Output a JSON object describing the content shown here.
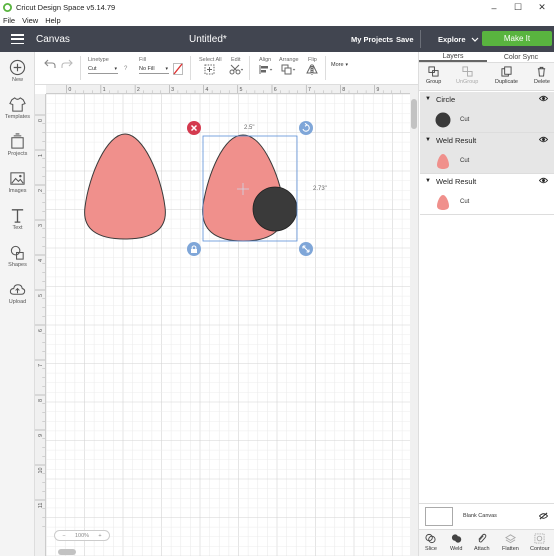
{
  "titlebar": {
    "title": "Cricut Design Space  v5.14.79"
  },
  "menu": [
    "File",
    "View",
    "Help"
  ],
  "header": {
    "canvas_label": "Canvas",
    "doc_title": "Untitled*",
    "my_projects": "My Projects",
    "save": "Save",
    "machine": "Explore",
    "make_it": "Make It",
    "accent": "#59b43f"
  },
  "sidebar": [
    {
      "label": "New",
      "icon": "plus-circle-icon"
    },
    {
      "label": "Templates",
      "icon": "shirt-icon"
    },
    {
      "label": "Projects",
      "icon": "projects-icon"
    },
    {
      "label": "Images",
      "icon": "image-icon"
    },
    {
      "label": "Text",
      "icon": "text-icon"
    },
    {
      "label": "Shapes",
      "icon": "shapes-icon"
    },
    {
      "label": "Upload",
      "icon": "cloud-upload-icon"
    }
  ],
  "toolbar": {
    "linetype_label": "Linetype",
    "linetype_value": "Cut",
    "fill_label": "Fill",
    "fill_value": "No Fill",
    "select_all": "Select All",
    "edit": "Edit",
    "align": "Align",
    "arrange": "Arrange",
    "flip": "Flip",
    "more": "More"
  },
  "canvas": {
    "h_ruler": [
      "0",
      "1",
      "2",
      "3",
      "4",
      "5",
      "6",
      "7",
      "8",
      "9"
    ],
    "v_ruler": [
      "0",
      "1",
      "2",
      "3",
      "4",
      "5",
      "6",
      "7",
      "8",
      "9",
      "10",
      "11"
    ],
    "width_label": "2.5\"",
    "height_label": "2.73\"",
    "zoom": "100%",
    "shape_color": "#f0908c",
    "circle_color": "#3a3a3a",
    "selection_color": "#5b8fd8"
  },
  "panel": {
    "tabs": [
      "Layers",
      "Color Sync"
    ],
    "actions": [
      "Group",
      "UnGroup",
      "Duplicate",
      "Delete"
    ],
    "layers": [
      {
        "name": "Circle",
        "item": "Cut",
        "color": "#3a3a3a"
      },
      {
        "name": "Weld Result",
        "item": "Cut",
        "color": "#f0908c"
      },
      {
        "name": "Weld Result",
        "item": "Cut",
        "color": "#f0908c"
      }
    ],
    "blank_canvas": "Blank Canvas",
    "bottom": [
      "Slice",
      "Weld",
      "Attach",
      "Flatten",
      "Contour"
    ]
  }
}
